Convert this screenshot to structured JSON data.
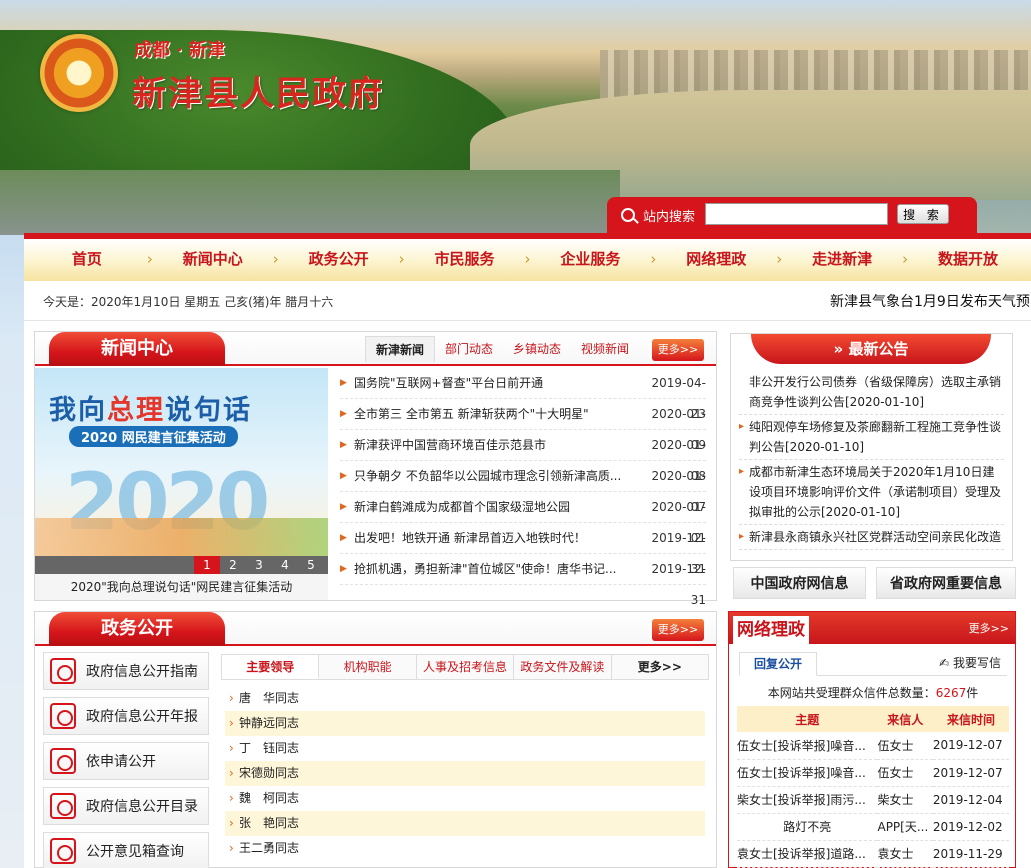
{
  "header": {
    "subtitle": "成都 · 新津",
    "title": "新津县人民政府"
  },
  "search": {
    "label": "站内搜索",
    "value": "",
    "button": "搜 索"
  },
  "nav": {
    "items": [
      "首页",
      "新闻中心",
      "政务公开",
      "市民服务",
      "企业服务",
      "网络理政",
      "走进新津",
      "数据开放"
    ]
  },
  "datebar": {
    "date": "今天是：2020年1月10日 星期五 己亥(猪)年 腊月十六",
    "ticker": "新津县气象台1月9日发布天气预"
  },
  "news": {
    "title": "新闻中心",
    "tabs": [
      "新津新闻",
      "部门动态",
      "乡镇动态",
      "视频新闻"
    ],
    "more": "更多>>",
    "slide": {
      "headline_a": "我向",
      "headline_b": "总理",
      "headline_c": "说句话",
      "pill": "2020 网民建言征集活动",
      "big": "2020",
      "numbers": [
        "1",
        "2",
        "3",
        "4",
        "5"
      ],
      "caption": "2020\"我向总理说句话\"网民建言征集活动"
    },
    "items": [
      {
        "title": "国务院\"互联网+督查\"平台日前开通",
        "date": "2019-04-23"
      },
      {
        "title": "全市第三 全市第五 新津斩获两个\"十大明星\"",
        "date": "2020-01-09"
      },
      {
        "title": "新津获评中国营商环境百佳示范县市",
        "date": "2020-01-08"
      },
      {
        "title": "只争朝夕 不负韶华以公园城市理念引领新津高质...",
        "date": "2020-01-07"
      },
      {
        "title": "新津白鹤滩成为成都首个国家级湿地公园",
        "date": "2020-01-01"
      },
      {
        "title": "出发吧！地铁开通 新津昂首迈入地铁时代！",
        "date": "2019-12-31"
      },
      {
        "title": "抢抓机遇，勇担新津\"首位城区\"使命！唐华书记...",
        "date": "2019-12-31"
      }
    ]
  },
  "notice": {
    "title": "» 最新公告",
    "items": [
      "非公开发行公司债券（省级保障房）选取主承销商竞争性谈判公告[2020-01-10]",
      "纯阳观停车场修复及茶廊翻新工程施工竞争性谈判公告[2020-01-10]",
      "成都市新津生态环境局关于2020年1月10日建设项目环境影响评价文件（承诺制项目）受理及拟审批的公示[2020-01-10]",
      "新津县永商镇永兴社区党群活动空间亲民化改造"
    ]
  },
  "links": {
    "gov": "中国政府网信息",
    "prov": "省政府网重要信息"
  },
  "affairs": {
    "title": "政务公开",
    "more": "更多>>",
    "side": [
      "政府信息公开指南",
      "政府信息公开年报",
      "依申请公开",
      "政府信息公开目录",
      "公开意见箱查询"
    ],
    "tabs": [
      "主要领导",
      "机构职能",
      "人事及招考信息",
      "政务文件及解读",
      "更多>>"
    ],
    "leaders": [
      "唐　华同志",
      "钟静远同志",
      "丁　钰同志",
      "宋德勋同志",
      "魏　柯同志",
      "张　艳同志",
      "王二勇同志"
    ]
  },
  "online": {
    "title": "网络理政",
    "more": "更多>>",
    "tab_reply": "回复公开",
    "tab_write": "我要写信",
    "count_label": "本网站共受理群众信件总数量：",
    "count_value": "6267",
    "count_unit": "件",
    "columns": [
      "主题",
      "来信人",
      "来信时间"
    ],
    "rows": [
      [
        "伍女士[投诉举报]噪音...",
        "伍女士",
        "2019-12-07"
      ],
      [
        "伍女士[投诉举报]噪音...",
        "伍女士",
        "2019-12-07"
      ],
      [
        "柴女士[投诉举报]雨污...",
        "柴女士",
        "2019-12-04"
      ],
      [
        "路灯不亮",
        "APP[天...",
        "2019-12-02"
      ],
      [
        "袁女士[投诉举报]道路...",
        "袁女士",
        "2019-11-29"
      ]
    ]
  }
}
